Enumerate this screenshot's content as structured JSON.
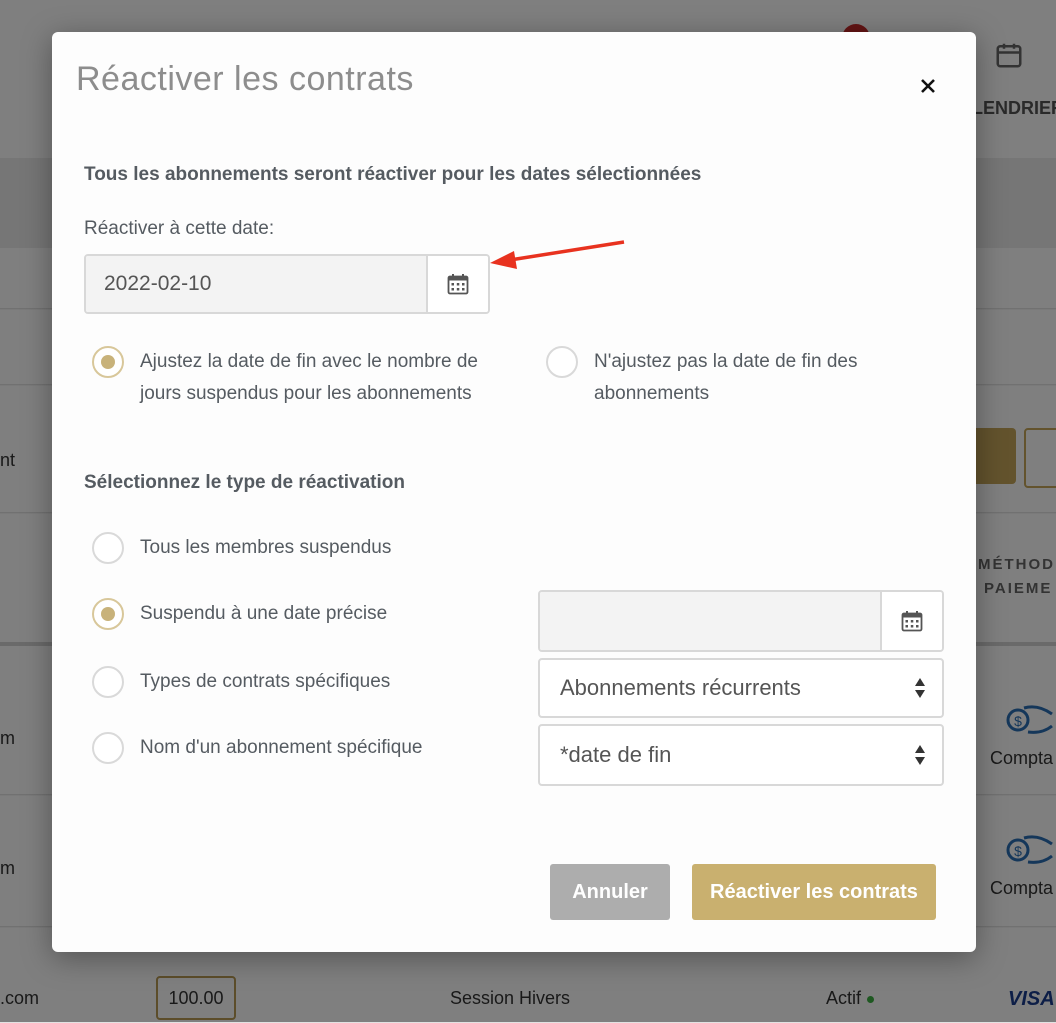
{
  "background": {
    "calendar_label": "LENDRIER",
    "row_fragment_1": "nt",
    "column_method_line1": "MÉTHOD",
    "column_method_line2": "PAIEME",
    "row_email_1": "m",
    "row_email_2": "m",
    "row_email_3": ".com",
    "row_payment_1": "Compta",
    "row_payment_2": "Compta",
    "row_price": "100.00",
    "row_session": "Session Hivers",
    "row_status": "Actif",
    "row_card_brand": "VISA"
  },
  "modal": {
    "title": "Réactiver les contrats",
    "section1_heading": "Tous les abonnements seront réactiver pour les dates sélectionnées",
    "date_label": "Réactiver à cette date:",
    "date_value": "2022-02-10",
    "option_adjust_line1": "Ajustez la date de fin avec le nombre de",
    "option_adjust_line2": "jours suspendus pour les abonnements",
    "option_no_adjust_line1": "N'ajustez pas la date de fin des",
    "option_no_adjust_line2": "abonnements",
    "section2_heading": "Sélectionnez le type de réactivation",
    "type_all": "Tous les membres suspendus",
    "type_date": "Suspendu à une date précise",
    "type_contracts": "Types de contrats spécifiques",
    "type_name": "Nom d'un abonnement spécifique",
    "specific_date_value": "",
    "contract_type_selected": "Abonnements récurrents",
    "subscription_name_selected": "*date de fin",
    "cancel_label": "Annuler",
    "submit_label": "Réactiver les contrats"
  },
  "colors": {
    "accent_gold": "#c9b06f",
    "cancel_gray": "#adadad",
    "annotation_red": "#e8321f"
  }
}
